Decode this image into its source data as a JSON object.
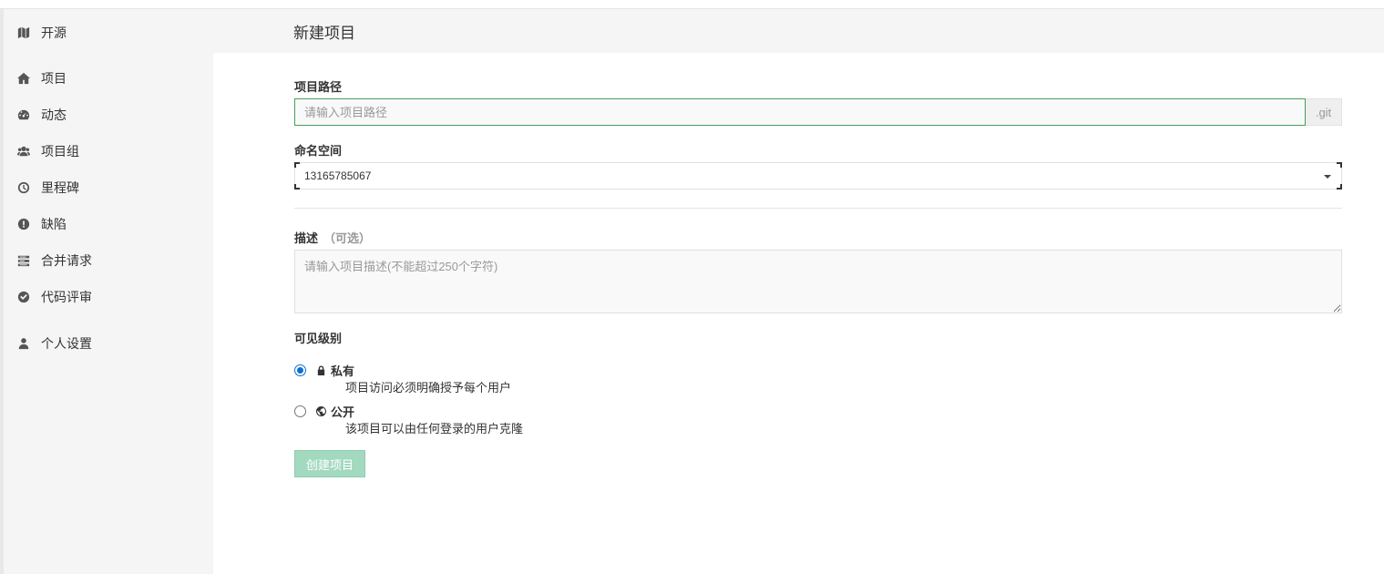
{
  "sidebar": {
    "items": [
      {
        "label": "开源",
        "icon": "map-icon"
      },
      {
        "label": "项目",
        "icon": "home-icon"
      },
      {
        "label": "动态",
        "icon": "dashboard-icon"
      },
      {
        "label": "项目组",
        "icon": "users-icon"
      },
      {
        "label": "里程碑",
        "icon": "clock-icon"
      },
      {
        "label": "缺陷",
        "icon": "exclamation-icon"
      },
      {
        "label": "合并请求",
        "icon": "tasks-icon"
      },
      {
        "label": "代码评审",
        "icon": "check-circle-icon"
      },
      {
        "label": "个人设置",
        "icon": "user-icon"
      }
    ]
  },
  "header": {
    "title": "新建项目"
  },
  "form": {
    "path_label": "项目路径",
    "path_placeholder": "请输入项目路径",
    "path_value": "",
    "path_suffix": ".git",
    "namespace_label": "命名空间",
    "namespace_value": "13165785067",
    "description_label": "描述",
    "description_optional": "（可选）",
    "description_placeholder": "请输入项目描述(不能超过250个字符)",
    "visibility_label": "可见级别",
    "visibility": [
      {
        "name": "私有",
        "icon": "lock-icon",
        "desc": "项目访问必须明确授予每个用户",
        "checked": true
      },
      {
        "name": "公开",
        "icon": "globe-icon",
        "desc": "该项目可以由任何登录的用户克隆",
        "checked": false
      }
    ],
    "submit_label": "创建项目"
  },
  "colors": {
    "sidebar_bg": "#f5f5f5",
    "input_focus_border": "#46a05a",
    "button_disabled_bg": "#a3d9bf",
    "radio_checked": "#0b6fd1"
  }
}
